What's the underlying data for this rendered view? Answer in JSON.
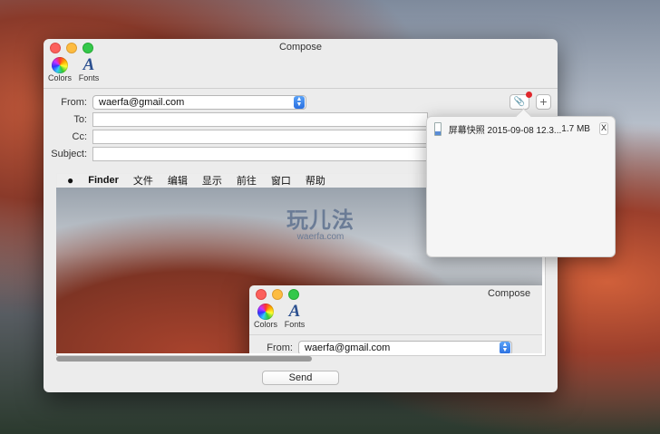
{
  "window": {
    "title": "Compose"
  },
  "toolbar": {
    "colors_label": "Colors",
    "fonts_label": "Fonts",
    "fonts_glyph": "A"
  },
  "form": {
    "from_label": "From:",
    "from_value": "waerfa@gmail.com",
    "to_label": "To:",
    "cc_label": "Cc:",
    "subject_label": "Subject:"
  },
  "buttons": {
    "send_label": "Send",
    "add_glyph": "+",
    "attach_glyph": "📎"
  },
  "attachment_popover": {
    "file_name": "屏幕快照 2015-09-08 12.3...",
    "file_size": "1.7 MB",
    "remove_label": "X"
  },
  "embedded_screenshot": {
    "menu": [
      "Finder",
      "文件",
      "编辑",
      "显示",
      "前往",
      "窗口",
      "帮助"
    ],
    "watermark_title": "玩儿法",
    "watermark_sub": "waerfa.com",
    "window_title": "Compose",
    "colors_label": "Colors",
    "fonts_label": "Fonts",
    "from_label": "From:",
    "from_value": "waerfa@gmail.com"
  },
  "colors": {
    "accent": "#2a6fe0",
    "badge": "#e0262b"
  }
}
